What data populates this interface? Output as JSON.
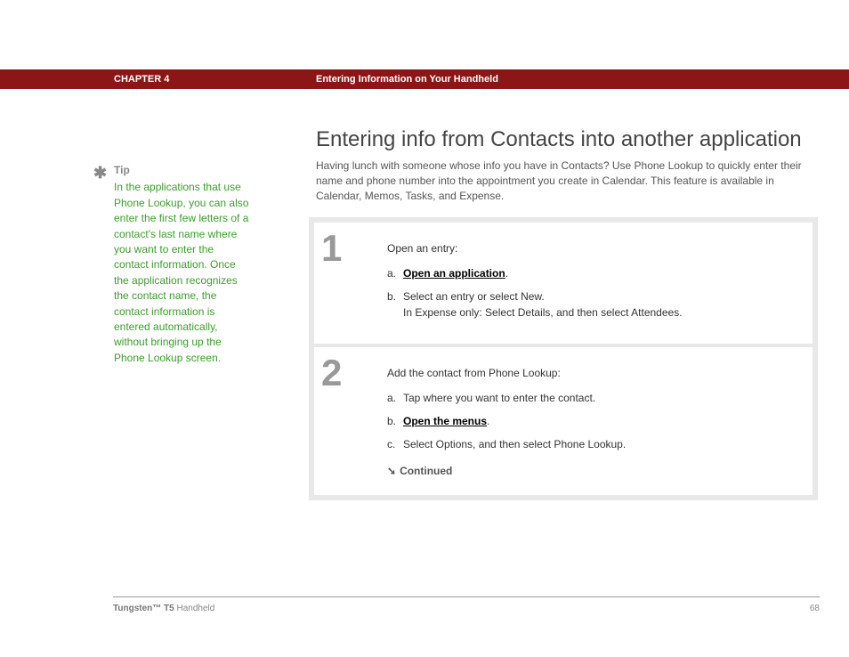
{
  "header": {
    "chapter": "CHAPTER 4",
    "section": "Entering Information on Your Handheld"
  },
  "tip": {
    "icon": "✱",
    "heading": "Tip",
    "text": "In the applications that use Phone Lookup, you can also enter the first few letters of a contact's last name where you want to enter the contact information. Once the application recognizes the contact name, the contact information is entered automatically, without bringing up the Phone Lookup screen."
  },
  "main": {
    "heading": "Entering info from Contacts into another application",
    "intro": "Having lunch with someone whose info you have in Contacts? Use Phone Lookup to quickly enter their name and phone number into the appointment you create in Calendar. This feature is available in Calendar, Memos, Tasks, and Expense."
  },
  "steps": [
    {
      "number": "1",
      "lead": "Open an entry:",
      "items": [
        {
          "marker": "a.",
          "link": "Open an application",
          "tail": "."
        },
        {
          "marker": "b.",
          "text": "Select an entry or select New.",
          "sub": "In Expense only: Select Details, and then select Attendees."
        }
      ]
    },
    {
      "number": "2",
      "lead": "Add the contact from Phone Lookup:",
      "items": [
        {
          "marker": "a.",
          "text": "Tap where you want to enter the contact."
        },
        {
          "marker": "b.",
          "link": "Open the menus",
          "tail": "."
        },
        {
          "marker": "c.",
          "text": "Select Options, and then select Phone Lookup."
        }
      ],
      "continued": "Continued"
    }
  ],
  "footer": {
    "product_bold": "Tungsten™ T5",
    "product_rest": " Handheld",
    "page": "68"
  }
}
